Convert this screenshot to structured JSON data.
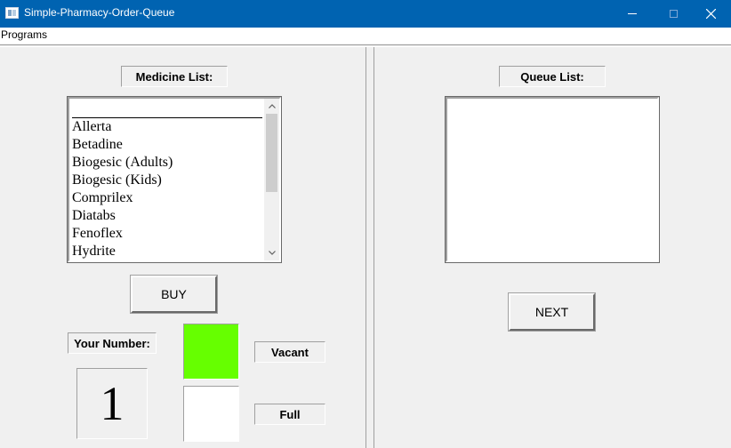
{
  "window": {
    "title": "Simple-Pharmacy-Order-Queue"
  },
  "menu": {
    "items": [
      "Programs"
    ]
  },
  "medicine_panel": {
    "label": "Medicine List:",
    "items": [
      "Allerta",
      "Betadine",
      "Biogesic (Adults)",
      "Biogesic (Kids)",
      "Comprilex",
      "Diatabs",
      "Fenoflex",
      "Hydrite"
    ],
    "buy_label": "BUY",
    "your_number_label": "Your Number:",
    "your_number_value": "1"
  },
  "status_legend": {
    "vacant_label": "Vacant",
    "vacant_color": "#66ff00",
    "full_label": "Full",
    "full_color": "#ffffff"
  },
  "queue_panel": {
    "label": "Queue List:",
    "items": [],
    "next_label": "NEXT"
  },
  "icons": {
    "app": "app-window-icon",
    "minimize": "minimize-icon",
    "maximize": "maximize-icon",
    "close": "close-icon",
    "scroll_up": "chevron-up-icon",
    "scroll_down": "chevron-down-icon"
  }
}
